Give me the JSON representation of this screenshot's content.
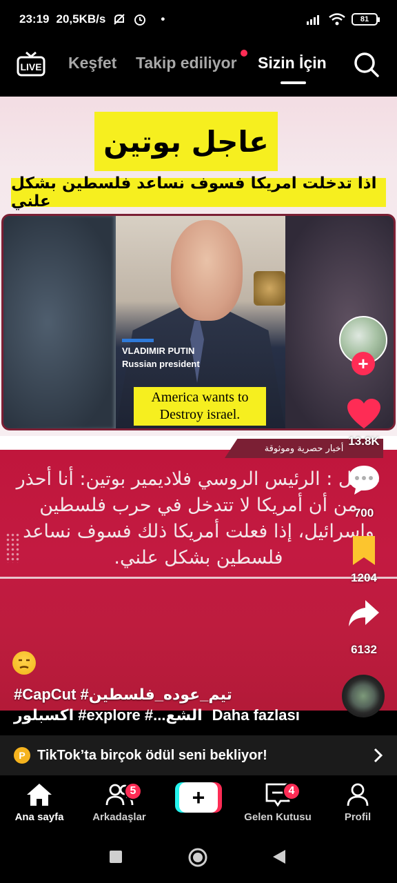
{
  "status_bar": {
    "time": "23:19",
    "speed": "20,5KB/s",
    "dot": "•",
    "battery": "81",
    "icons": [
      "mute-icon",
      "alarm-icon",
      "signal-icon",
      "wifi-icon",
      "battery-icon"
    ]
  },
  "top_nav": {
    "live_label": "LIVE",
    "tabs": [
      {
        "label": "Keşfet",
        "active": false
      },
      {
        "label": "Takip ediliyor",
        "active": false,
        "has_dot": true
      },
      {
        "label": "Sizin İçin",
        "active": true
      }
    ]
  },
  "video": {
    "headline": "عاجل بوتين",
    "subline": "اذا تدخلت امريكا فسوف نساعد فلسطين بشكل علني",
    "name_line1": "VLADIMIR PUTIN",
    "name_line2": "Russian president",
    "quote": "America wants to Destroy israel.",
    "brand_tag": "أخبار حصرية وموثوقة",
    "body_text": "عاجل : الرئيس الروسي فلاديمير بوتين: أنا أحذر من أن أمريكا لا تتدخل في حرب فلسطين وإسرائيل، إذا فعلت أمريكا ذلك فسوف نساعد فلسطين بشكل علني."
  },
  "actions": {
    "likes": "13.8K",
    "comments": "700",
    "saves": "1204",
    "shares": "6132",
    "colors": {
      "like": "#fe2c55",
      "save": "#fcc52e"
    }
  },
  "caption": {
    "line1": "#CapCut #تيم_عوده_فلسطين",
    "line2": "اكسبلور #explore #...الشع",
    "more": "Daha fazlası"
  },
  "reward": {
    "coin": "P",
    "text": "TikTok’ta birçok ödül seni bekliyor!"
  },
  "bottom_nav": {
    "items": [
      {
        "label": "Ana sayfa",
        "active": true
      },
      {
        "label": "Arkadaşlar",
        "badge": "5"
      },
      {
        "label": "Gelen Kutusu",
        "badge": "4"
      },
      {
        "label": "Profil"
      }
    ]
  },
  "theme": {
    "accent": "#fe2c55",
    "accent2": "#25f4ee",
    "panel_red": "#c0163c",
    "highlight_yellow": "#f6ef1f"
  }
}
